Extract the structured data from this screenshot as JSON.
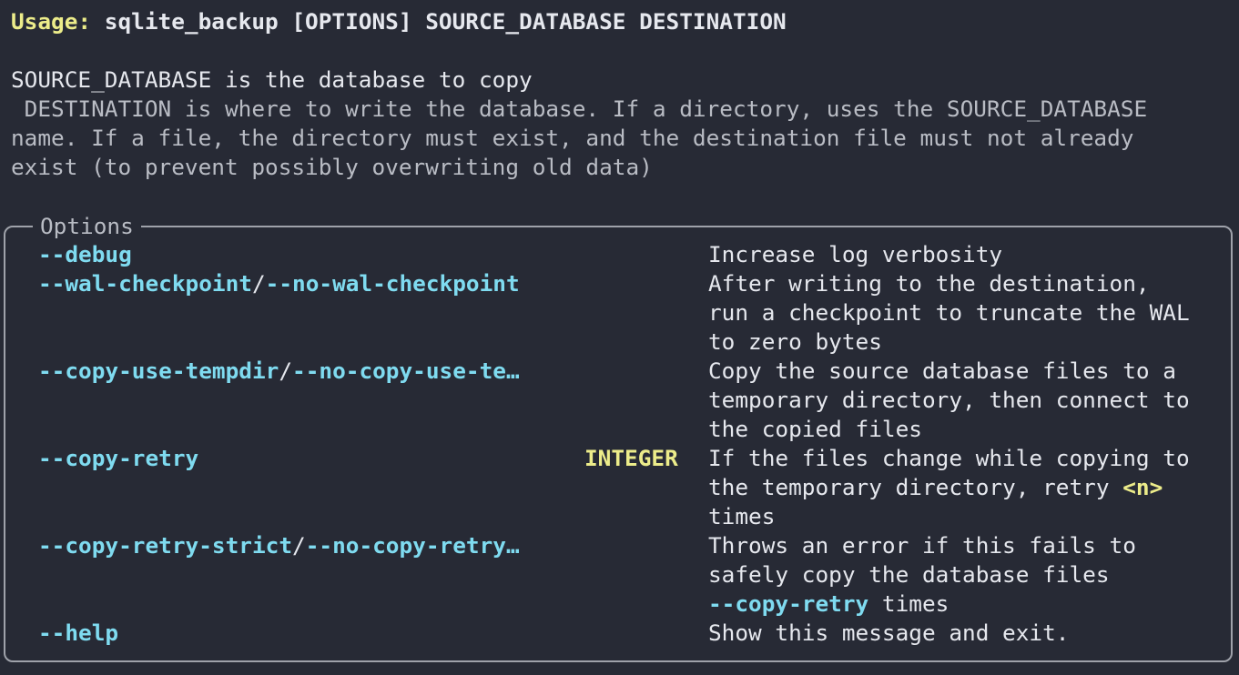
{
  "usage": {
    "label": "Usage:",
    "command": " sqlite_backup [OPTIONS] SOURCE_DATABASE DESTINATION"
  },
  "description": {
    "line1": "SOURCE_DATABASE is the database to copy",
    "line2": " DESTINATION is where to write the database. If a directory, uses the SOURCE_DATABASE",
    "line3": "name. If a file, the directory must exist, and the destination file must not already",
    "line4": "exist (to prevent possibly overwriting old data)"
  },
  "options_panel": {
    "title": "Options",
    "options": [
      {
        "flag": "--debug",
        "desc": [
          "Increase log verbosity"
        ]
      },
      {
        "flag": "--wal-checkpoint",
        "sep": "/",
        "neg": "--no-wal-checkpoint",
        "desc": [
          "After writing to the destination,",
          "run a checkpoint to truncate the WAL",
          "to zero bytes"
        ]
      },
      {
        "flag": "--copy-use-tempdir",
        "sep": "/",
        "neg": "--no-copy-use-te…",
        "desc": [
          "Copy the source database files to a",
          "temporary directory, then connect to",
          "the copied files"
        ]
      },
      {
        "flag": "--copy-retry",
        "metavar": "INTEGER",
        "desc": [
          "If the files change while copying to",
          "the temporary directory, retry ",
          "times"
        ],
        "desc_token": "<n>"
      },
      {
        "flag": "--copy-retry-strict",
        "sep": "/",
        "neg": "--no-copy-retry…",
        "desc": [
          "Throws an error if this fails to",
          "safely copy the database files",
          " times"
        ],
        "desc_flag": "--copy-retry"
      },
      {
        "flag": "--help",
        "desc": [
          "Show this message and exit."
        ]
      }
    ]
  }
}
